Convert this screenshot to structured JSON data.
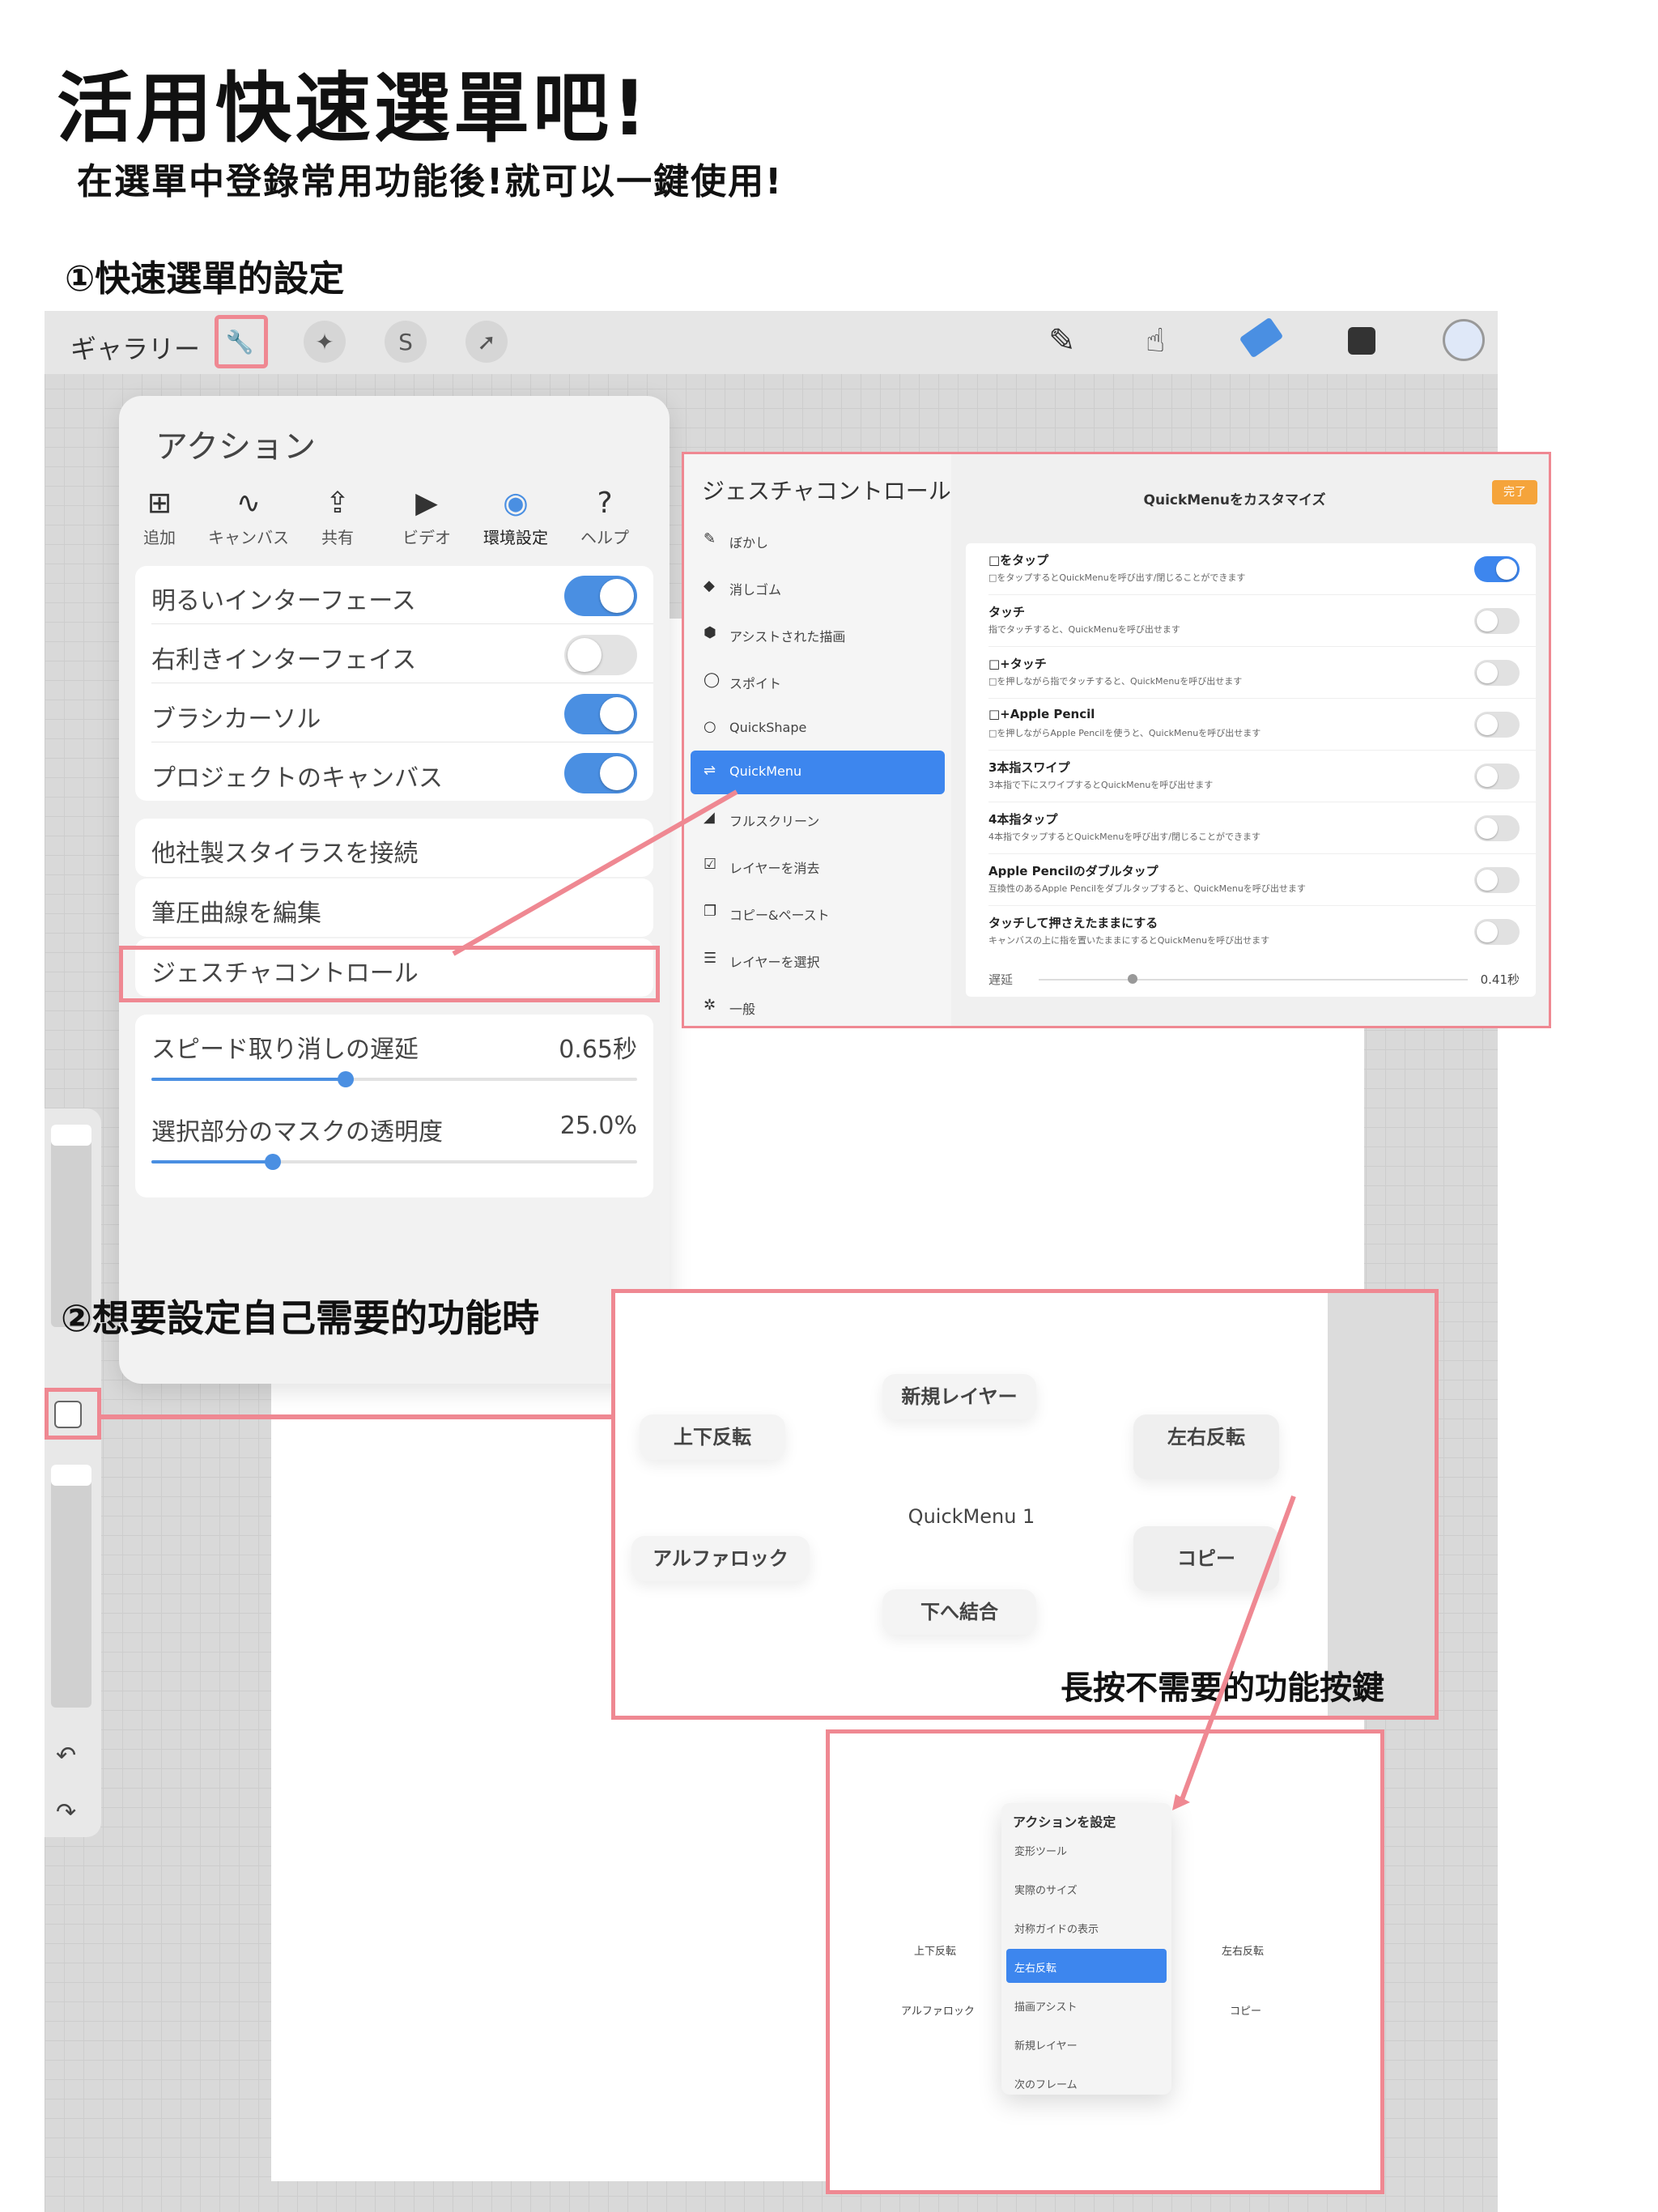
{
  "header": {
    "title": "活用快速選單吧!",
    "subtitle": "在選單中登錄常用功能後!就可以一鍵使用!",
    "step1": "①快速選單的設定",
    "step2": "②想要設定自己需要的功能時",
    "note": "長按不需要的功能按鍵"
  },
  "topbar": {
    "gallery": "ギャラリー",
    "left_icons": [
      "wrench-icon",
      "magic-wand-icon",
      "selection-icon",
      "transform-arrow-icon"
    ],
    "right_icons": [
      "brush-icon",
      "smudge-icon",
      "eraser-icon",
      "layers-icon",
      "color-icon"
    ]
  },
  "actions": {
    "title": "アクション",
    "tabs": [
      {
        "label": "追加",
        "icon": "add-icon"
      },
      {
        "label": "キャンバス",
        "icon": "canvas-icon"
      },
      {
        "label": "共有",
        "icon": "share-icon"
      },
      {
        "label": "ビデオ",
        "icon": "play-icon"
      },
      {
        "label": "環境設定",
        "icon": "toggle-icon"
      },
      {
        "label": "ヘルプ",
        "icon": "help-icon"
      }
    ],
    "toggles": [
      {
        "label": "明るいインターフェース",
        "on": true
      },
      {
        "label": "右利きインターフェイス",
        "on": false
      },
      {
        "label": "ブラシカーソル",
        "on": true
      },
      {
        "label": "プロジェクトのキャンバス",
        "on": true
      }
    ],
    "links": [
      "他社製スタイラスを接続",
      "筆圧曲線を編集",
      "ジェスチャコントロール"
    ],
    "sliders": [
      {
        "label": "スピード取り消しの遅延",
        "value": "0.65秒",
        "fraction": 0.4
      },
      {
        "label": "選択部分のマスクの透明度",
        "value": "25.0%",
        "fraction": 0.25
      }
    ]
  },
  "gesture": {
    "title": "ジェスチャコントロール",
    "items": [
      {
        "label": "ぼかし",
        "icon": "blur-icon"
      },
      {
        "label": "消しゴム",
        "icon": "eraser-icon"
      },
      {
        "label": "アシストされた描画",
        "icon": "assist-icon"
      },
      {
        "label": "スポイト",
        "icon": "eyedropper-icon"
      },
      {
        "label": "QuickShape",
        "icon": "quickshape-icon"
      },
      {
        "label": "QuickMenu",
        "icon": "quickmenu-icon"
      },
      {
        "label": "フルスクリーン",
        "icon": "fullscreen-icon"
      },
      {
        "label": "レイヤーを消去",
        "icon": "clear-layer-icon"
      },
      {
        "label": "コピー&ペースト",
        "icon": "copy-paste-icon"
      },
      {
        "label": "レイヤーを選択",
        "icon": "select-layer-icon"
      },
      {
        "label": "一般",
        "icon": "gear-icon"
      }
    ],
    "active_index": 5,
    "panel_title": "QuickMenuをカスタマイズ",
    "done": "完了",
    "options": [
      {
        "title": "□をタップ",
        "desc": "□をタップするとQuickMenuを呼び出す/閉じることができます",
        "on": true
      },
      {
        "title": "タッチ",
        "desc": "指でタッチすると、QuickMenuを呼び出せます",
        "on": false
      },
      {
        "title": "□+タッチ",
        "desc": "□を押しながら指でタッチすると、QuickMenuを呼び出せます",
        "on": false
      },
      {
        "title": "□+Apple Pencil",
        "desc": "□を押しながらApple Pencilを使うと、QuickMenuを呼び出せます",
        "on": false
      },
      {
        "title": "3本指スワイプ",
        "desc": "3本指で下にスワイプするとQuickMenuを呼び出せます",
        "on": false
      },
      {
        "title": "4本指タップ",
        "desc": "4本指でタップするとQuickMenuを呼び出す/閉じることができます",
        "on": false
      },
      {
        "title": "Apple Pencilのダブルタップ",
        "desc": "互換性のあるApple Pencilをダブルタップすると、QuickMenuを呼び出せます",
        "on": false
      },
      {
        "title": "タッチして押さえたままにする",
        "desc": "キャンバスの上に指を置いたままにするとQuickMenuを呼び出せます",
        "on": false
      }
    ],
    "delay_label": "遅延",
    "delay_value": "0.41秒",
    "delay_fraction": 0.18
  },
  "quickmenu": {
    "center": "QuickMenu 1",
    "top": "新規レイヤー",
    "upper_left": "上下反転",
    "upper_right": "左右反転",
    "lower_left": "アルファロック",
    "lower_right": "コピー",
    "bottom": "下へ結合"
  },
  "set_action_menu": {
    "title": "アクションを設定",
    "items": [
      "変形ツール",
      "実際のサイズ",
      "対称ガイドの表示",
      "左右反転",
      "描画アシスト",
      "新規レイヤー",
      "次のフレーム"
    ],
    "selected_index": 3,
    "side_upper_left": "上下反転",
    "side_upper_right": "左右反転",
    "side_lower_left": "アルファロック",
    "side_lower_right": "コピー"
  },
  "colors": {
    "highlight": "#ef8892",
    "accent_blue": "#3d86ee",
    "done_orange": "#f5a43b"
  }
}
